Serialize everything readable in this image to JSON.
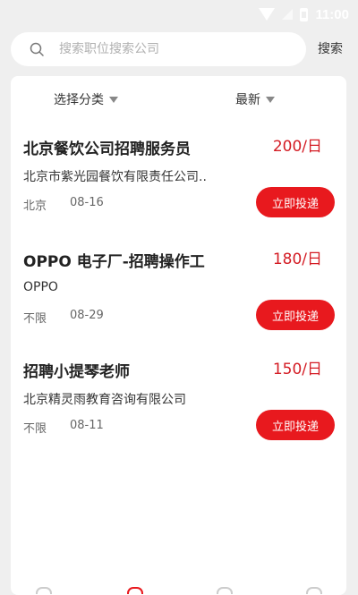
{
  "status_bar": {
    "time": "11:00"
  },
  "search": {
    "placeholder": "搜索职位搜索公司",
    "button_label": "搜索"
  },
  "filters": {
    "category_label": "选择分类",
    "sort_label": "最新"
  },
  "jobs": [
    {
      "title": "北京餐饮公司招聘服务员",
      "salary": "200/日",
      "company": "北京市紫光园餐饮有限责任公司..",
      "location": "北京",
      "date": "08-16",
      "apply_label": "立即投递"
    },
    {
      "title": "OPPO 电子厂-招聘操作工",
      "salary": "180/日",
      "company": "OPPO",
      "location": "不限",
      "date": "08-29",
      "apply_label": "立即投递"
    },
    {
      "title": "招聘小提琴老师",
      "salary": "150/日",
      "company": "北京精灵雨教育咨询有限公司",
      "location": "不限",
      "date": "08-11",
      "apply_label": "立即投递"
    }
  ],
  "colors": {
    "accent": "#e8191e",
    "salary": "#d41c24",
    "background": "#efefef"
  },
  "icons": [
    "wifi-icon",
    "signal-icon",
    "battery-icon",
    "search-icon",
    "dropdown-arrow-icon"
  ]
}
